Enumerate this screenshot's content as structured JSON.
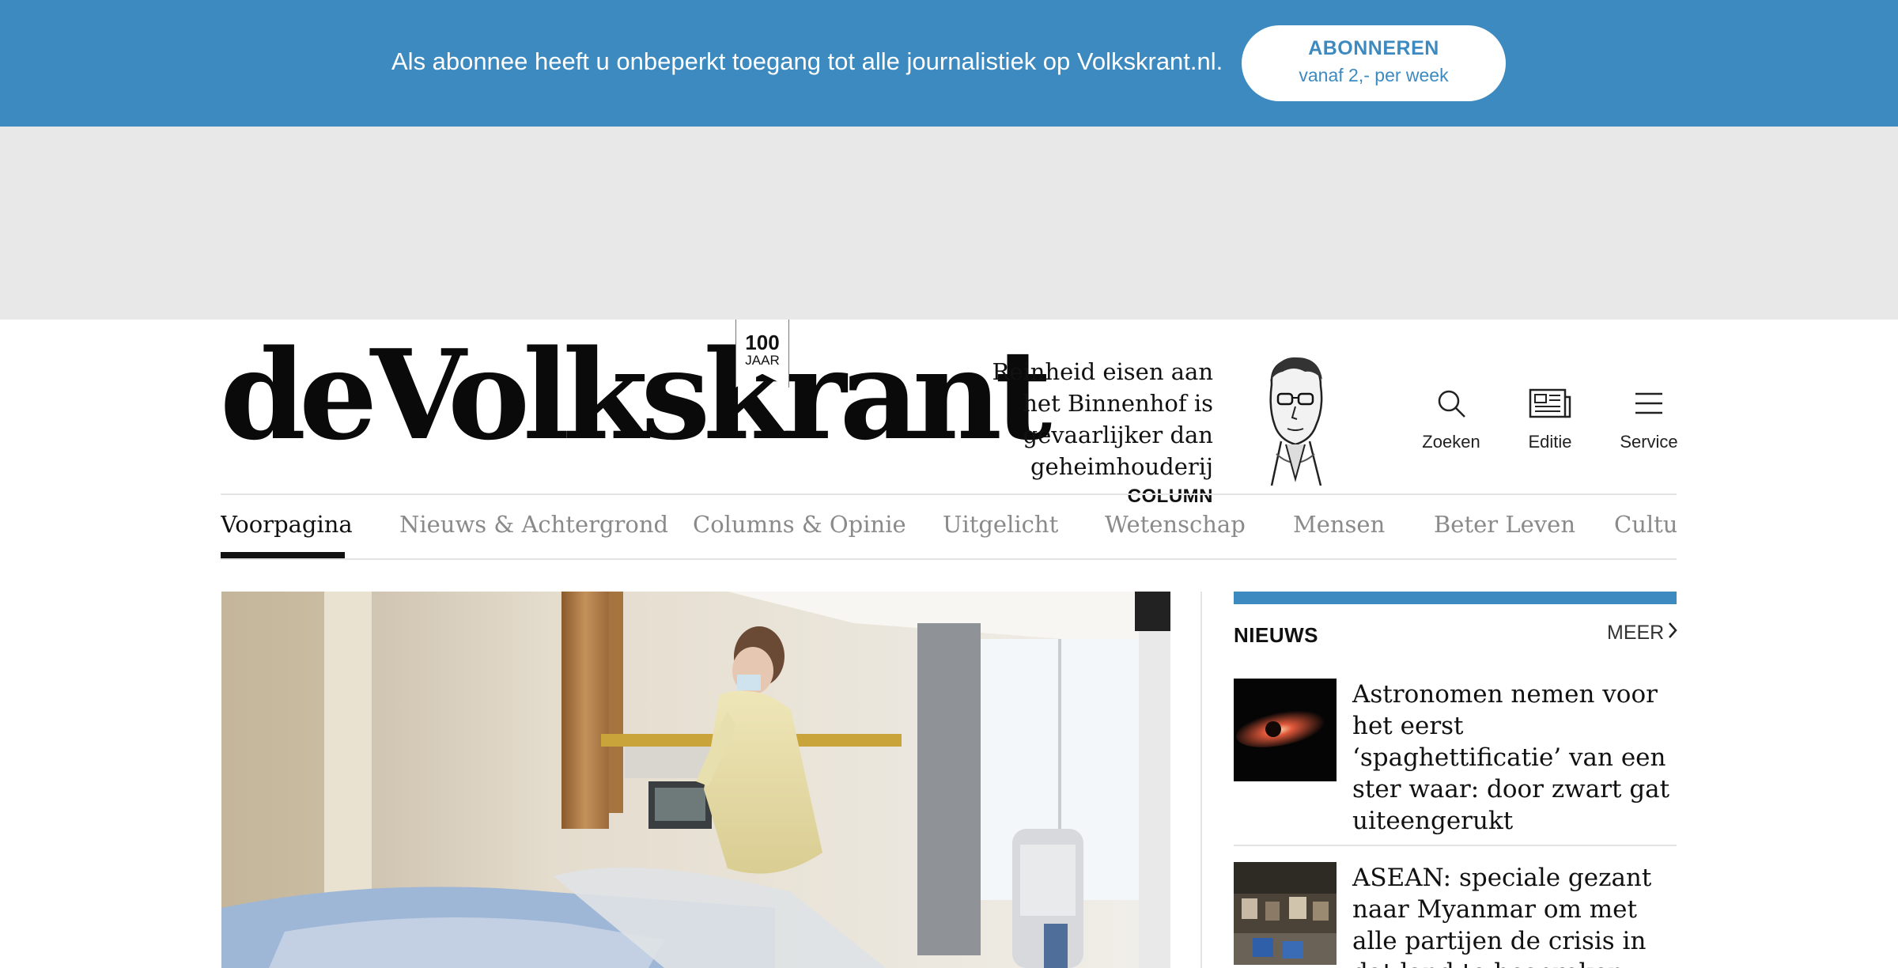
{
  "banner": {
    "text": "Als abonnee heeft u onbeperkt toegang tot alle journalistiek op Volkskrant.nl.",
    "button_label": "ABONNEREN",
    "button_sub": "vanaf 2,- per week"
  },
  "header": {
    "logo_text": "deVolkskrant",
    "badge_number": "100",
    "badge_label": "JAAR",
    "column": {
      "title": "Reinheid eisen aan het Binnenhof is gevaarlijker dan geheimhouderij",
      "kicker": "COLUMN"
    },
    "tools": [
      {
        "label": "Zoeken",
        "icon": "search-icon"
      },
      {
        "label": "Editie",
        "icon": "newspaper-icon"
      },
      {
        "label": "Service",
        "icon": "menu-icon"
      }
    ]
  },
  "nav": {
    "items": [
      {
        "label": "Voorpagina",
        "active": true
      },
      {
        "label": "Nieuws & Achtergrond"
      },
      {
        "label": "Columns & Opinie"
      },
      {
        "label": "Uitgelicht"
      },
      {
        "label": "Wetenschap"
      },
      {
        "label": "Mensen"
      },
      {
        "label": "Beter Leven"
      },
      {
        "label": "Cultuur"
      }
    ]
  },
  "sidebar": {
    "heading": "NIEUWS",
    "more": "MEER",
    "items": [
      {
        "title": "Astronomen nemen voor het eerst ‘spaghettificatie’ van een ster waar: door zwart gat uiteengerukt"
      },
      {
        "title": "ASEAN: speciale gezant naar Myanmar om met alle partijen de crisis in dat land te bespreken"
      }
    ]
  },
  "colors": {
    "brand_blue": "#3c8abf",
    "ad_gray": "#e8e8e8"
  }
}
